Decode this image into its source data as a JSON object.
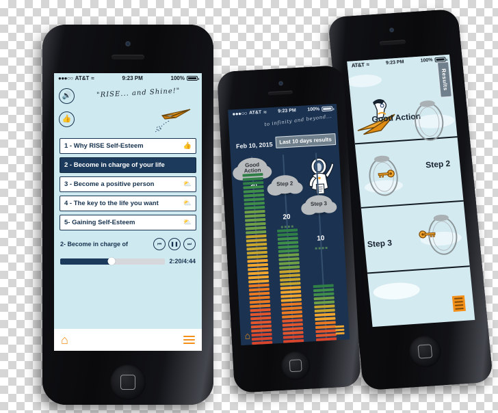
{
  "app": {
    "name": "RISE Self-Esteem",
    "accent_orange": "#f39019",
    "navy": "#15314d",
    "screen_blue": "#cfe9f0",
    "chart_navy": "#1b3250"
  },
  "phone1": {
    "status": {
      "carrier": "AT&T",
      "signal_dots": "●●●○○",
      "wifi": "≈",
      "time": "9:23 PM",
      "battery": "100%"
    },
    "hero": {
      "quote": "\"RISE... and Shine!\"",
      "speaker_icon": "speaker-icon",
      "thumb_icon": "thumbs-up-icon",
      "plane_icon": "paper-plane-icon"
    },
    "lessons": [
      {
        "label": "1 - Why RISE Self-Esteem",
        "icon": "thumbs-up-icon",
        "active": false
      },
      {
        "label": "2 - Become in charge of your life",
        "icon": "",
        "active": true
      },
      {
        "label": "3 - Become a positive person",
        "icon": "download-cloud-icon",
        "active": false
      },
      {
        "label": "4 - The key to the life you want",
        "icon": "download-cloud-icon",
        "active": false
      },
      {
        "label": "5- Gaining Self-Esteem",
        "icon": "download-cloud-icon",
        "active": false
      }
    ],
    "player": {
      "track": "2- Become in charge of",
      "prev_label": "⏮",
      "pause_label": "❚❚",
      "next_label": "⏭",
      "elapsed_total": "2:20/4:44",
      "progress_percent": 49
    },
    "tabbar": {
      "home_icon": "home-icon",
      "menu_icon": "hamburger-menu-icon"
    }
  },
  "phone2": {
    "status": {
      "carrier": "AT&T",
      "signal_dots": "●●●○○",
      "wifi": "≈",
      "time": "9:23 PM",
      "battery": "100%"
    },
    "quote": "to infinity and beyond...",
    "date": "Feb 10, 2015",
    "results_pill": "Last 10 days results",
    "astronaut_icon": "astronaut-icon",
    "home_icon": "home-icon",
    "menu_icon": "hamburger-menu-icon",
    "chart_data": {
      "type": "bar",
      "title": "Last 10 days results",
      "subtitle": "Feb 10, 2015",
      "categories": [
        "Good Action",
        "Step 2",
        "Step 3"
      ],
      "values": [
        30,
        20,
        10
      ],
      "value_labels": [
        "30",
        "20",
        "10"
      ],
      "xlabel": "",
      "ylabel": "",
      "ylim": [
        0,
        30
      ],
      "grid": false,
      "legend": "none",
      "segment_colors": [
        "#d7452c",
        "#e2562e",
        "#ea7b22",
        "#f0a52e",
        "#c8a52c",
        "#6fa046",
        "#3f8f4a",
        "#2f7f46"
      ],
      "note": "Each column is a vertical stack of small colored segments forming a gradient from red at the bottom through orange to green at the top; column height encodes the value."
    }
  },
  "phone3": {
    "status": {
      "carrier": "AT&T",
      "wifi": "≈",
      "time": "9:23 PM",
      "battery": "100%"
    },
    "results_tab": "Results",
    "rows": [
      {
        "label": "Good Action",
        "ring_icon": "ring-hoop-icon",
        "key_icon": ""
      },
      {
        "label": "Step 2",
        "ring_icon": "ring-hoop-icon",
        "key_icon": "key-icon"
      },
      {
        "label": "Step 3",
        "ring_icon": "ring-hoop-icon",
        "key_icon": "key-icon"
      }
    ],
    "plane_icon": "paper-plane-rider-icon",
    "menu_icon": "menu-button-icon"
  }
}
